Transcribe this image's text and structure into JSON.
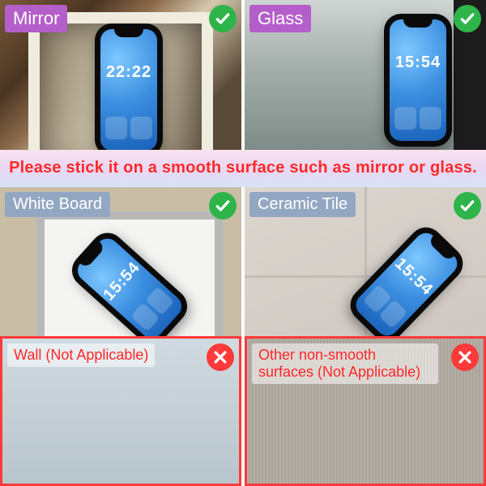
{
  "banner": "Please stick it on a smooth surface such as mirror or glass.",
  "cells": {
    "mirror": {
      "label": "Mirror",
      "status": "ok",
      "phone_time": "22:22"
    },
    "glass": {
      "label": "Glass",
      "status": "ok",
      "phone_time": "15:54"
    },
    "whiteboard": {
      "label": "White Board",
      "status": "ok",
      "phone_time": "15:54"
    },
    "ceramictile": {
      "label": "Ceramic Tile",
      "status": "ok",
      "phone_time": "15:54"
    },
    "wall": {
      "label": "Wall (Not Applicable)",
      "status": "no"
    },
    "nonsmooth": {
      "label": "Other non-smooth surfaces  (Not Applicable)",
      "status": "no"
    }
  },
  "icons": {
    "check": "check-icon",
    "cross": "cross-icon"
  }
}
